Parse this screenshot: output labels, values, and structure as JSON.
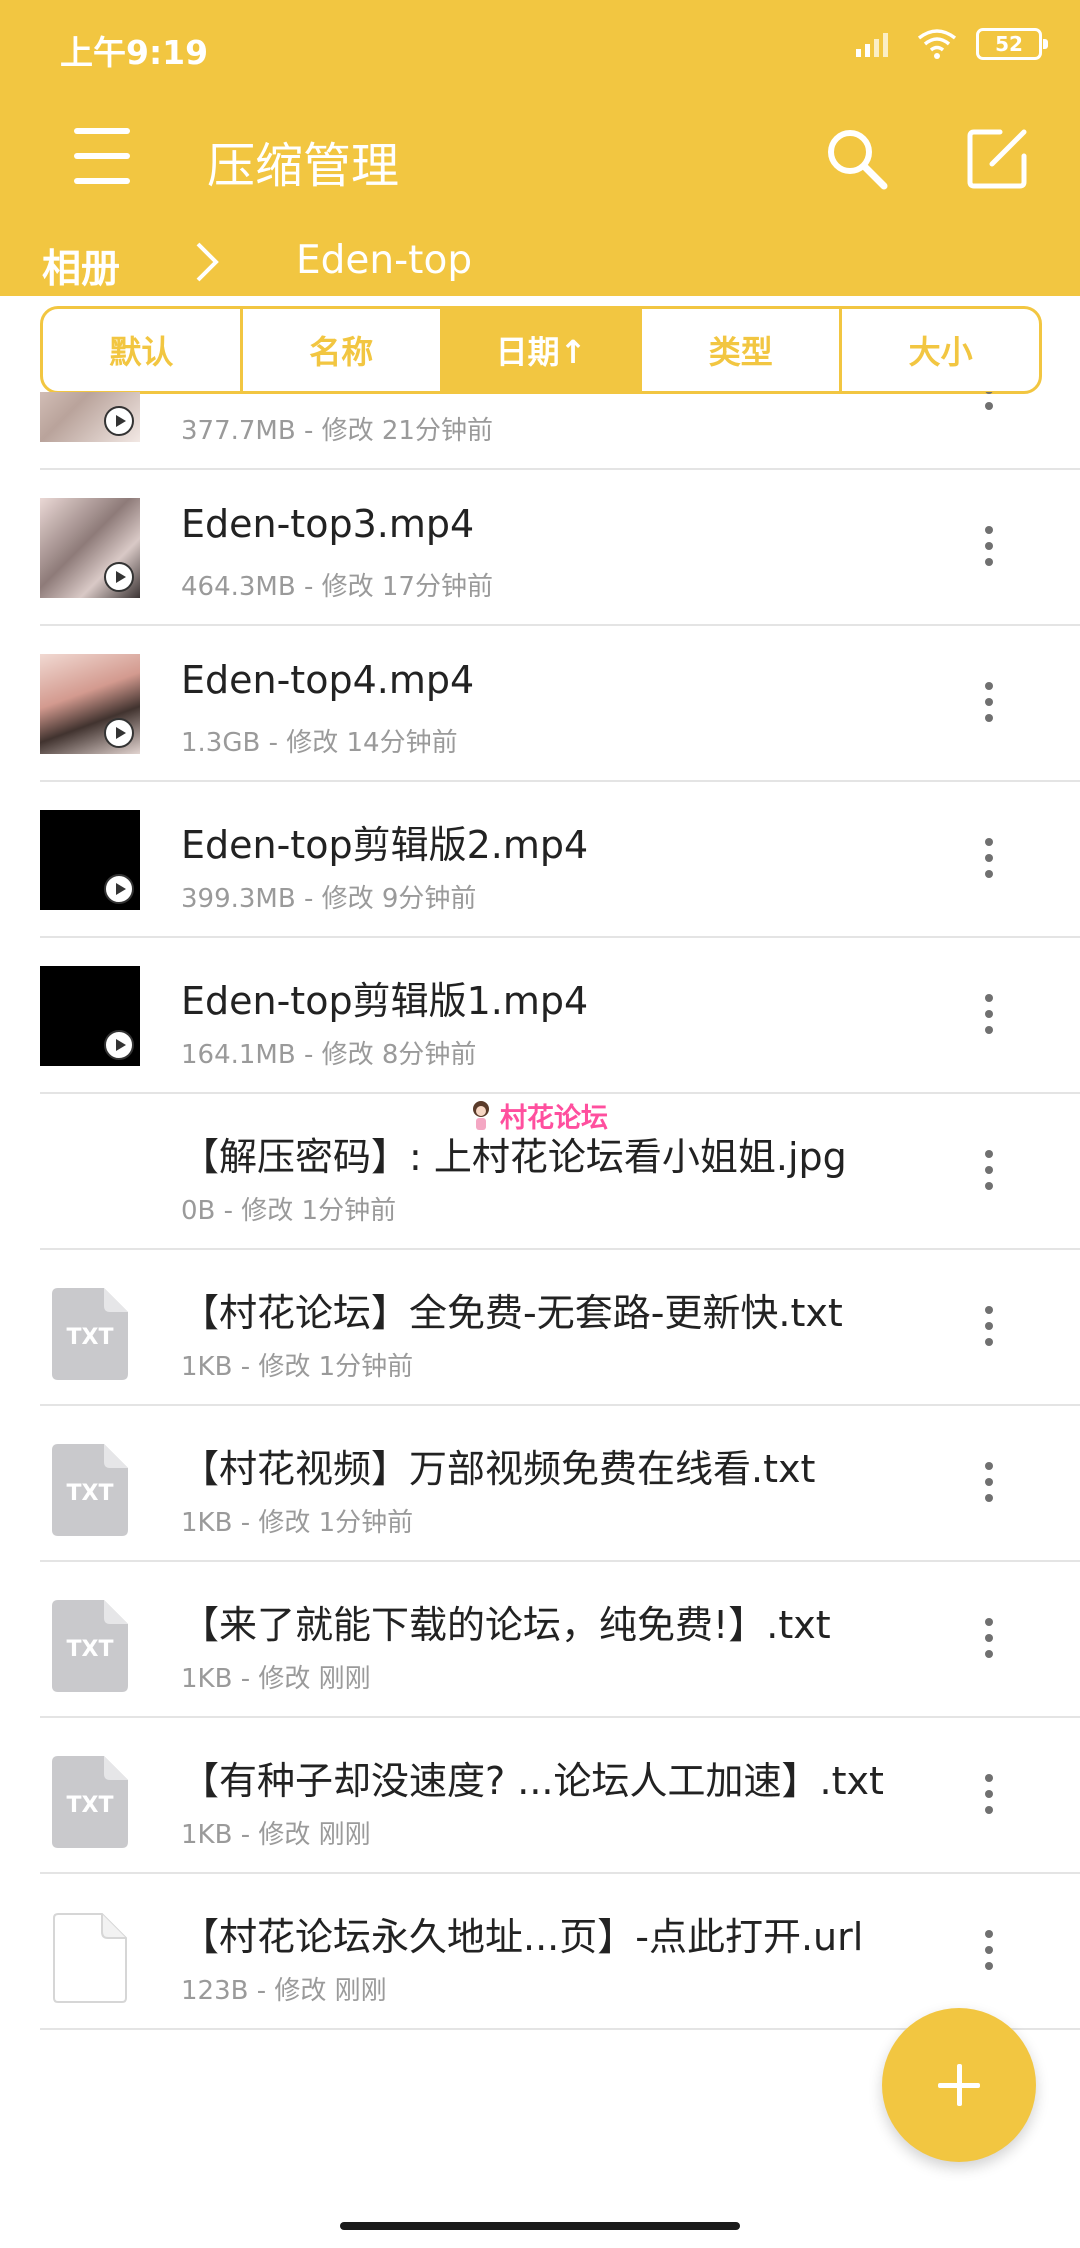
{
  "status": {
    "time": "上午9:19",
    "battery": "52"
  },
  "header": {
    "title": "压缩管理"
  },
  "breadcrumb": {
    "root": "相册",
    "current": "Eden-top"
  },
  "sort_tabs": [
    {
      "label": "默认",
      "active": false
    },
    {
      "label": "名称",
      "active": false
    },
    {
      "label": "日期↑",
      "active": true
    },
    {
      "label": "类型",
      "active": false
    },
    {
      "label": "大小",
      "active": false
    }
  ],
  "files": [
    {
      "name": "",
      "meta": "377.7MB - 修改 21分钟前",
      "icon": "video-thumbnail"
    },
    {
      "name": "Eden-top3.mp4",
      "meta": "464.3MB - 修改 17分钟前",
      "icon": "video-thumbnail"
    },
    {
      "name": "Eden-top4.mp4",
      "meta": "1.3GB - 修改 14分钟前",
      "icon": "video-thumbnail"
    },
    {
      "name": "Eden-top剪辑版2.mp4",
      "meta": "399.3MB - 修改 9分钟前",
      "icon": "video-thumbnail"
    },
    {
      "name": "Eden-top剪辑版1.mp4",
      "meta": "164.1MB - 修改 8分钟前",
      "icon": "video-thumbnail"
    },
    {
      "name": "【解压密码】: 上村花论坛看小姐姐.jpg",
      "meta": "0B - 修改 1分钟前",
      "icon": "image-file-icon"
    },
    {
      "name": "【村花论坛】全免费-无套路-更新快.txt",
      "meta": "1KB - 修改 1分钟前",
      "icon": "txt-file-icon"
    },
    {
      "name": "【村花视频】万部视频免费在线看.txt",
      "meta": "1KB - 修改 1分钟前",
      "icon": "txt-file-icon"
    },
    {
      "name": "【来了就能下载的论坛，纯免费!】.txt",
      "meta": "1KB - 修改 刚刚",
      "icon": "txt-file-icon"
    },
    {
      "name": "【有种子却没速度? ...论坛人工加速】.txt",
      "meta": "1KB - 修改 刚刚",
      "icon": "txt-file-icon"
    },
    {
      "name": "【村花论坛永久地址...页】-点此打开.url",
      "meta": "123B - 修改 刚刚",
      "icon": "blank-file-icon"
    }
  ],
  "watermark": {
    "text": "村花论坛"
  },
  "txt_badge": "TXT",
  "colors": {
    "accent": "#f2c641",
    "meta_text": "#9a9a9a",
    "watermark": "#ff4f9e"
  }
}
